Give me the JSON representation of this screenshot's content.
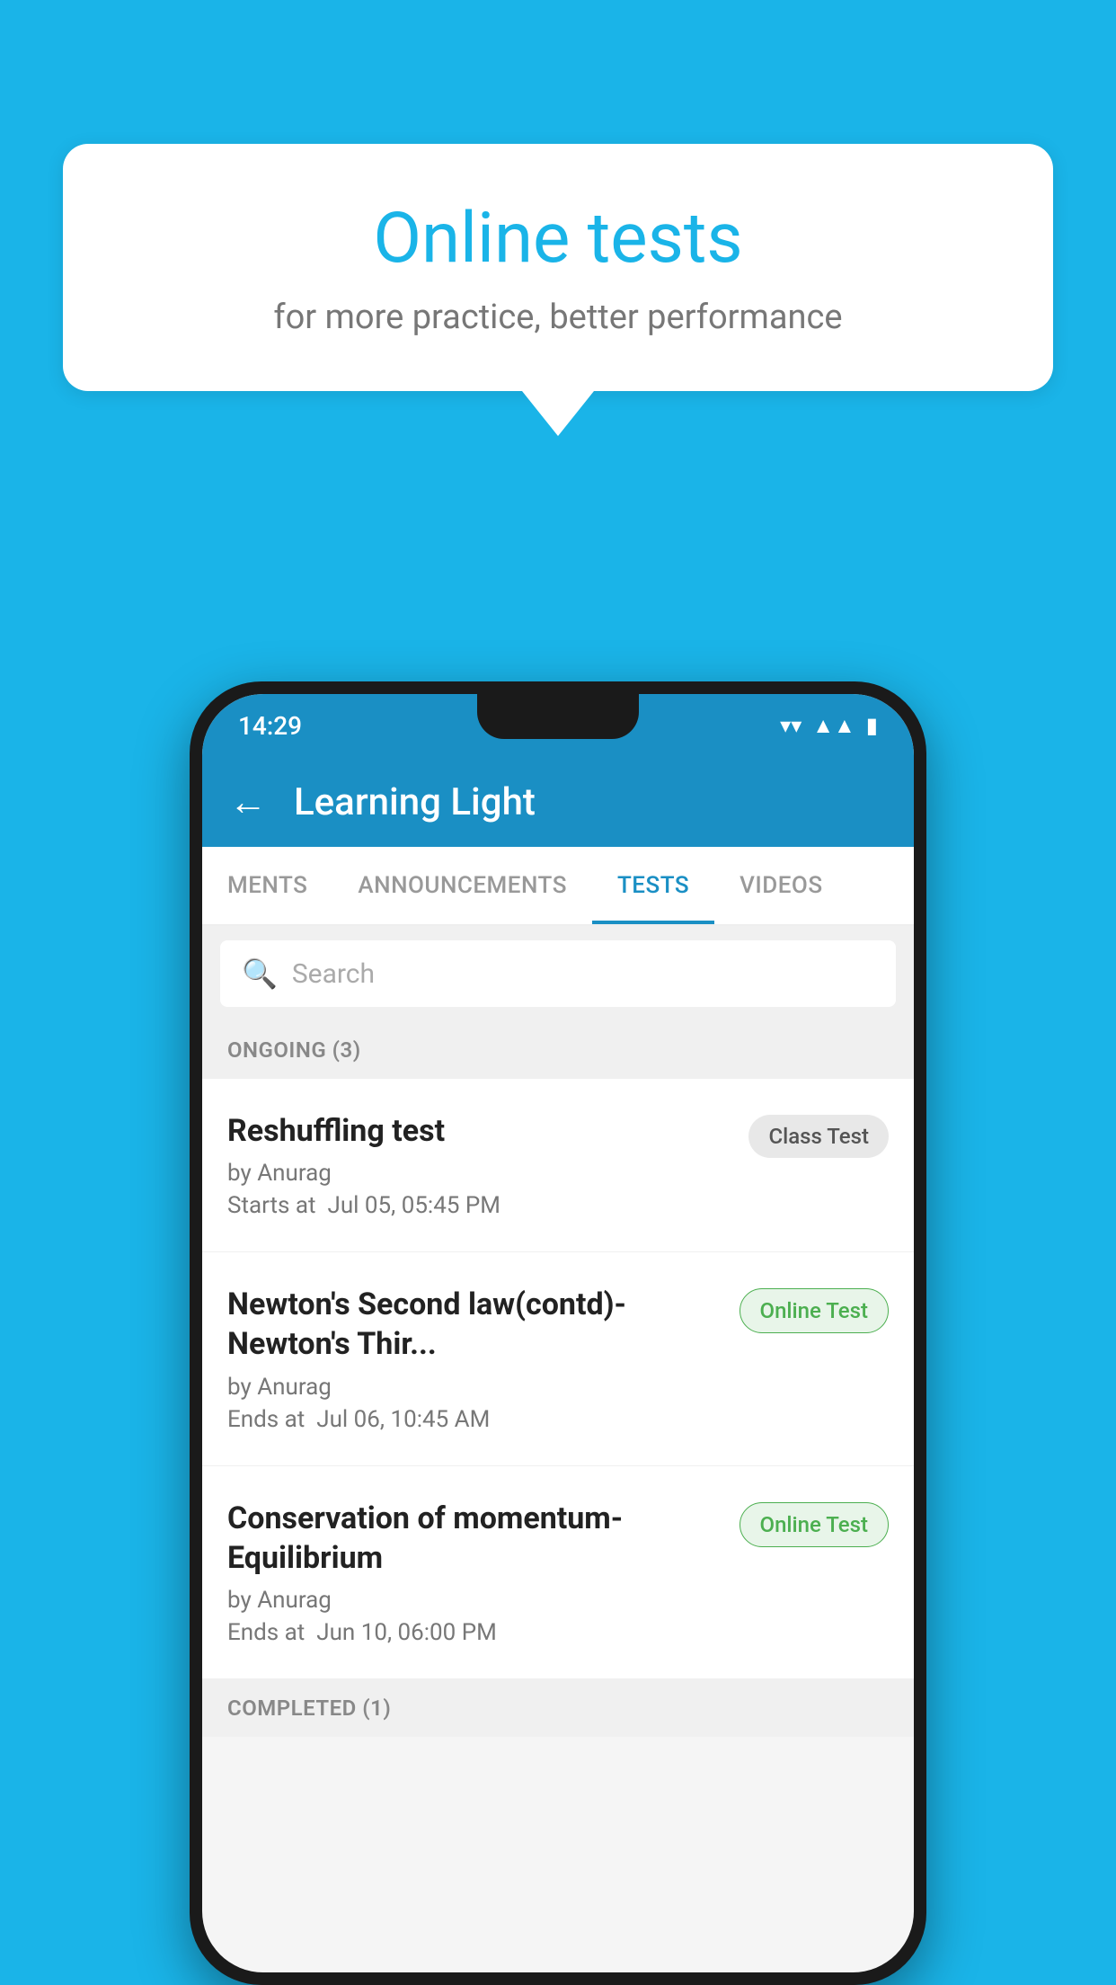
{
  "background": {
    "color": "#1ab4e8"
  },
  "speech_bubble": {
    "title": "Online tests",
    "subtitle": "for more practice, better performance"
  },
  "status_bar": {
    "time": "14:29",
    "icons": [
      "wifi",
      "signal",
      "battery"
    ]
  },
  "header": {
    "back_label": "←",
    "title": "Learning Light"
  },
  "tabs": [
    {
      "label": "MENTS",
      "active": false
    },
    {
      "label": "ANNOUNCEMENTS",
      "active": false
    },
    {
      "label": "TESTS",
      "active": true
    },
    {
      "label": "VIDEOS",
      "active": false
    }
  ],
  "search": {
    "placeholder": "Search"
  },
  "ongoing_section": {
    "title": "ONGOING (3)"
  },
  "tests": [
    {
      "name": "Reshuffling test",
      "author": "by Anurag",
      "date_label": "Starts at",
      "date": "Jul 05, 05:45 PM",
      "badge": "Class Test",
      "badge_type": "class"
    },
    {
      "name": "Newton's Second law(contd)-Newton's Thir...",
      "author": "by Anurag",
      "date_label": "Ends at",
      "date": "Jul 06, 10:45 AM",
      "badge": "Online Test",
      "badge_type": "online"
    },
    {
      "name": "Conservation of momentum-Equilibrium",
      "author": "by Anurag",
      "date_label": "Ends at",
      "date": "Jun 10, 06:00 PM",
      "badge": "Online Test",
      "badge_type": "online"
    }
  ],
  "completed_section": {
    "title": "COMPLETED (1)"
  }
}
